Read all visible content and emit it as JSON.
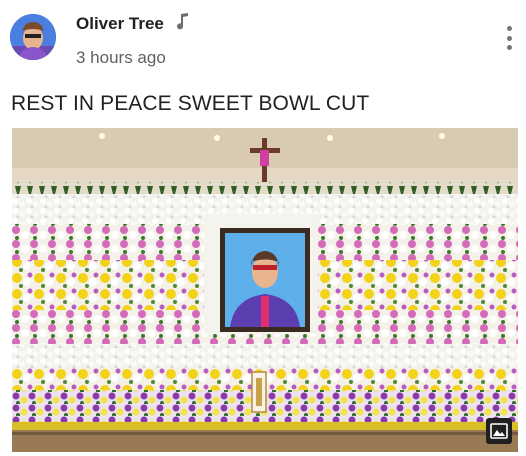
{
  "post": {
    "author_name": "Oliver Tree",
    "author_badge_icon": "music-note-icon",
    "timestamp": "3 hours ago",
    "menu_icon": "more-vertical-icon",
    "text": "REST IN PEACE SWEET BOWL CUT",
    "image_badge_icon": "image-icon"
  }
}
